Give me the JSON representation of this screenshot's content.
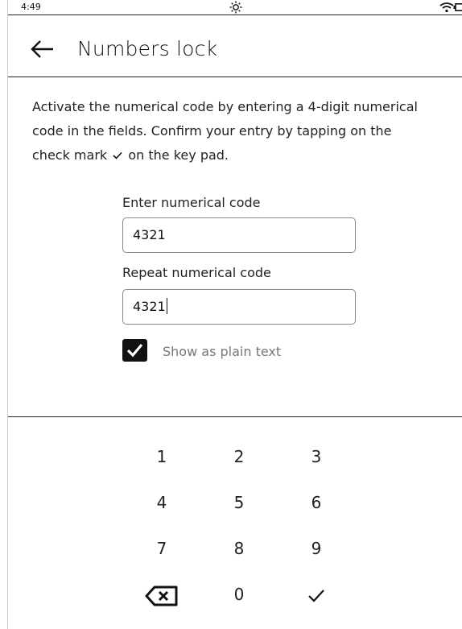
{
  "status_bar": {
    "time": "4:49",
    "icons": [
      "brightness-icon",
      "wifi-icon",
      "battery-icon"
    ]
  },
  "header": {
    "title": "Numbers lock",
    "back_icon": "back-arrow-icon"
  },
  "description": {
    "line1": "Activate the numerical code by entering a 4-digit numerical",
    "line2": "code in the fields. Confirm your entry by tapping on the",
    "line3_before": "check mark",
    "line3_after": "on the key pad."
  },
  "form": {
    "enter_label": "Enter numerical code",
    "enter_value": "4321",
    "repeat_label": "Repeat numerical code",
    "repeat_value": "4321",
    "show_plain_label": "Show as plain text",
    "show_plain_checked": true
  },
  "keypad": {
    "rows": [
      [
        "1",
        "2",
        "3"
      ],
      [
        "4",
        "5",
        "6"
      ],
      [
        "7",
        "8",
        "9"
      ],
      [
        "backspace-icon",
        "0",
        "check-icon"
      ]
    ]
  },
  "colors": {
    "text": "#111111",
    "muted": "#777777",
    "border": "#888888",
    "checkbox": "#111111"
  }
}
